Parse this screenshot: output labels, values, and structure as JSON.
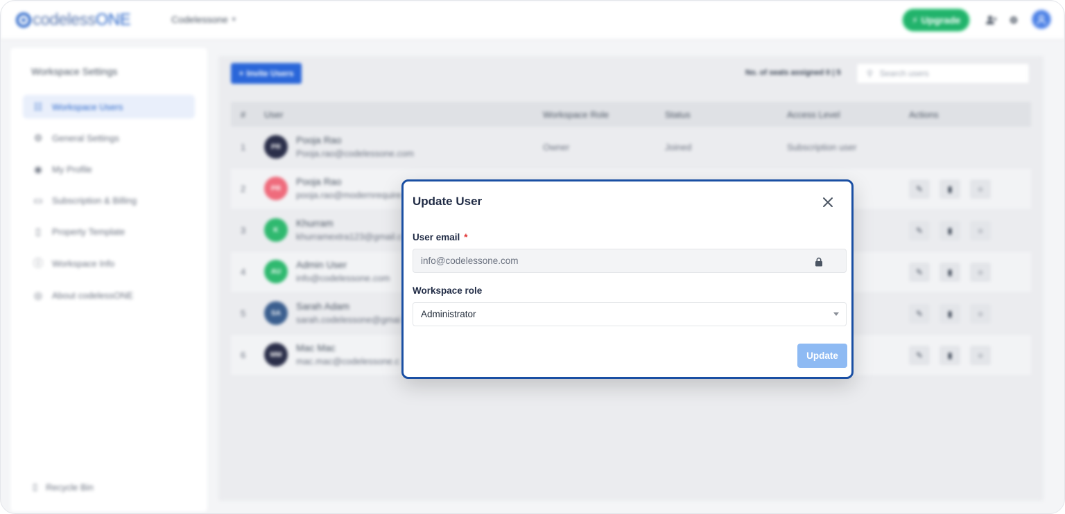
{
  "topbar": {
    "logo_prefix": "codeless",
    "logo_suffix": "ONE",
    "workspace": "Codelessone",
    "upgrade_label": "Upgrade"
  },
  "sidebar": {
    "title": "Workspace Settings",
    "items": [
      {
        "label": "Workspace Users",
        "icon": "users-icon",
        "active": true
      },
      {
        "label": "General Settings",
        "icon": "settings-icon"
      },
      {
        "label": "My Profile",
        "icon": "profile-icon"
      },
      {
        "label": "Subscription & Billing",
        "icon": "billing-icon"
      },
      {
        "label": "Property Template",
        "icon": "template-icon"
      },
      {
        "label": "Workspace Info",
        "icon": "info-icon"
      },
      {
        "label": "About codelessONE",
        "icon": "about-icon"
      }
    ],
    "recycle_label": "Recycle Bin"
  },
  "main": {
    "invite_label": "Invite Users",
    "seats_text": "No. of seats assigned 0 | 5",
    "search_placeholder": "Search users",
    "columns": [
      "#",
      "User",
      "Workspace Role",
      "Status",
      "Access Level",
      "Actions"
    ],
    "rows": [
      {
        "idx": "1",
        "name": "Pooja Rao",
        "email": "Pooja.rao@codelessone.com",
        "role": "Owner",
        "status": "Joined",
        "access": "Subscription user",
        "avatar_color": "#2b2f4a"
      },
      {
        "idx": "2",
        "name": "Pooja Rao",
        "email": "pooja.rao@modernrequire",
        "role": "",
        "status": "",
        "access": "",
        "avatar_color": "#ef6b7c"
      },
      {
        "idx": "3",
        "name": "Khurram",
        "email": "khurramextra123@gmail.c",
        "role": "",
        "status": "",
        "access": "",
        "avatar_color": "#2fb96f"
      },
      {
        "idx": "4",
        "name": "Admin User",
        "email": "info@codelessone.com",
        "role": "",
        "status": "",
        "access": "",
        "avatar_color": "#2fb96f"
      },
      {
        "idx": "5",
        "name": "Sarah Adam",
        "email": "sarah.codelessone@gmai",
        "role": "",
        "status": "",
        "access": "",
        "avatar_color": "#3b5f8f"
      },
      {
        "idx": "6",
        "name": "Mac Mac",
        "email": "mac.mac@codelessone.c",
        "role": "",
        "status": "",
        "access": "",
        "avatar_color": "#2b2f4a"
      }
    ]
  },
  "modal": {
    "title": "Update User",
    "email_label": "User email",
    "email_required": "*",
    "email_value": "info@codelessone.com",
    "role_label": "Workspace role",
    "role_value": "Administrator",
    "submit_label": "Update",
    "colors": {
      "border": "#1a4fa3",
      "button": "#8ebaf3"
    }
  }
}
